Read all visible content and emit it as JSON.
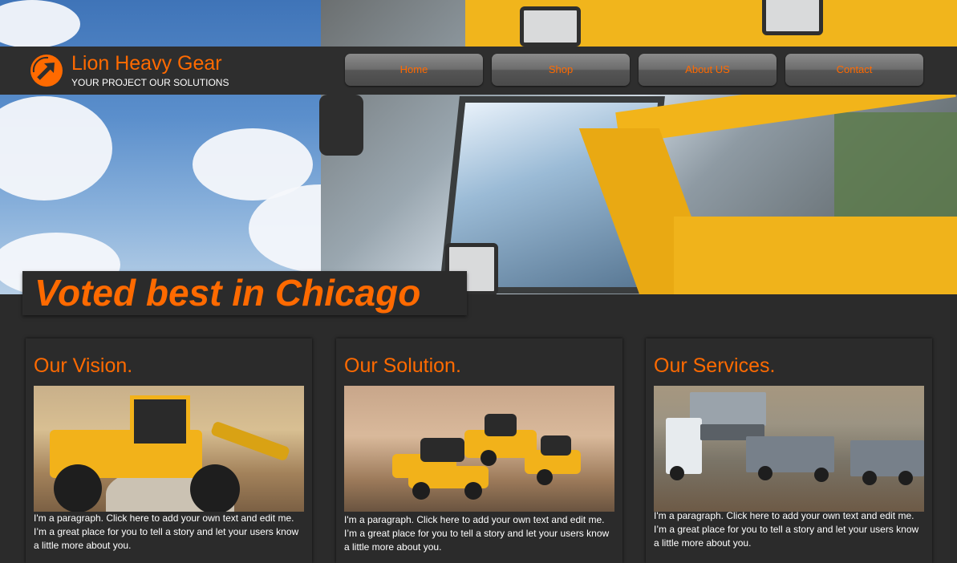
{
  "header": {
    "brand_name": "Lion Heavy Gear",
    "tagline": "YOUR PROJECT OUR SOLUTIONS",
    "logo_icon": "arrow-up-right-icon"
  },
  "nav": {
    "items": [
      {
        "label": "Home"
      },
      {
        "label": "Shop"
      },
      {
        "label": "About US"
      },
      {
        "label": "Contact"
      }
    ]
  },
  "hero": {
    "slogan": "Voted best in Chicago"
  },
  "cards": [
    {
      "title": "Our Vision.",
      "text": "I'm a paragraph. Click here to add your own text and edit me. I’m a great place for you to tell a story and let your users know a little more about you."
    },
    {
      "title": "Our Solution.",
      "text": "I'm a paragraph. Click here to add your own text and edit me. I’m a great place for you to tell a story and let your users know a little more about you."
    },
    {
      "title": "Our Services.",
      "text": "I'm a paragraph. Click here to add your own text and edit me. I’m a great place for you to tell a story and let your users know a little more about you."
    }
  ],
  "colors": {
    "accent": "#ff6a00",
    "background": "#2b2b2b",
    "header": "#2e2e2e"
  }
}
